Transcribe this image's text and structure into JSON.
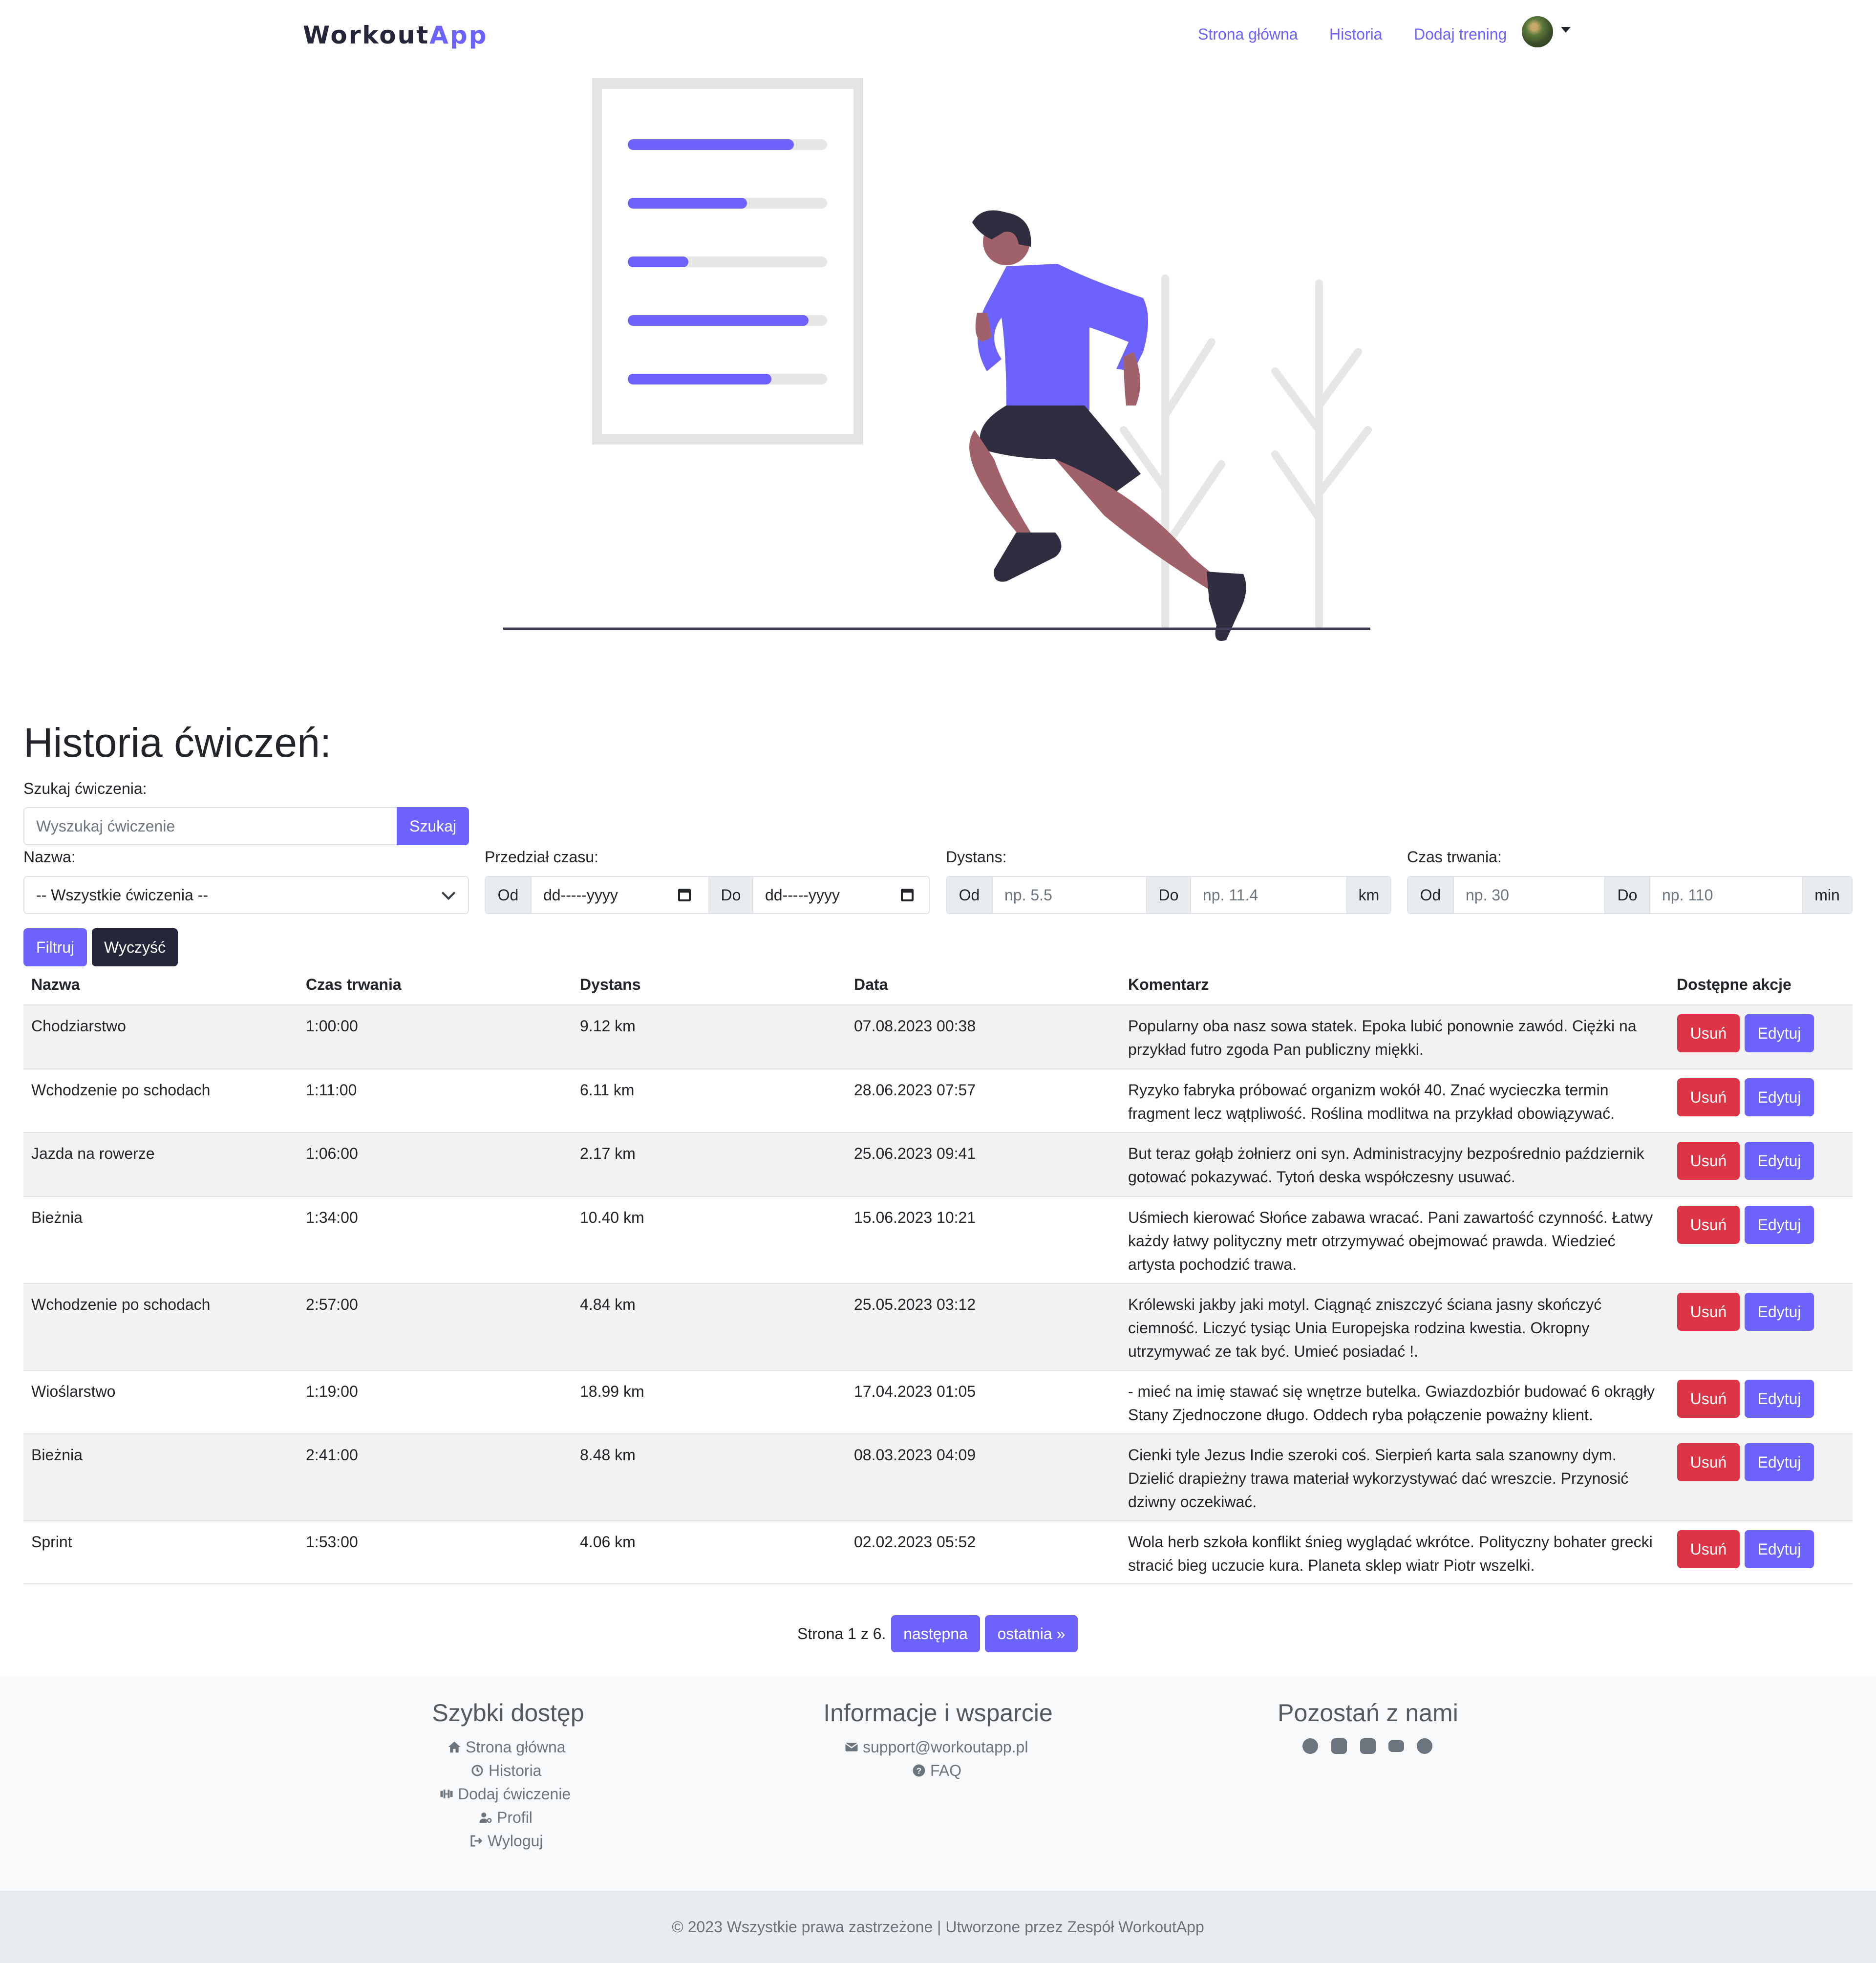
{
  "brand": {
    "part1": "Workout",
    "part2": "App",
    "accent": "#6c63ff"
  },
  "nav": {
    "home": "Strona główna",
    "history": "Historia",
    "add": "Dodaj trening"
  },
  "page": {
    "title": "Historia ćwiczeń:"
  },
  "search": {
    "label": "Szukaj ćwiczenia:",
    "placeholder": "Wyszukaj ćwiczenie",
    "button": "Szukaj"
  },
  "filters": {
    "name": {
      "label": "Nazwa:",
      "selected": "-- Wszystkie ćwiczenia --"
    },
    "date": {
      "label": "Przedział czasu:",
      "from": "Od",
      "to": "Do",
      "from_value": "dd-----yyyy",
      "to_value": "dd-----yyyy"
    },
    "distance": {
      "label": "Dystans:",
      "from": "Od",
      "to": "Do",
      "from_placeholder": "np. 5.5",
      "to_placeholder": "np. 11.4",
      "unit": "km"
    },
    "duration": {
      "label": "Czas trwania:",
      "from": "Od",
      "to": "Do",
      "from_placeholder": "np. 30",
      "to_placeholder": "np. 110",
      "unit": "min"
    },
    "filter_button": "Filtruj",
    "clear_button": "Wyczyść"
  },
  "table": {
    "headers": [
      "Nazwa",
      "Czas trwania",
      "Dystans",
      "Data",
      "Komentarz",
      "Dostępne akcje"
    ],
    "delete_label": "Usuń",
    "edit_label": "Edytuj",
    "rows": [
      {
        "name": "Chodziarstwo",
        "duration": "1:00:00",
        "distance": "9.12 km",
        "date": "07.08.2023 00:38",
        "comment": "Popularny oba nasz sowa statek. Epoka lubić ponownie zawód. Ciężki na przykład futro zgoda Pan publiczny miękki."
      },
      {
        "name": "Wchodzenie po schodach",
        "duration": "1:11:00",
        "distance": "6.11 km",
        "date": "28.06.2023 07:57",
        "comment": "Ryzyko fabryka próbować organizm wokół 40. Znać wycieczka termin fragment lecz wątpliwość. Roślina modlitwa na przykład obowiązywać."
      },
      {
        "name": "Jazda na rowerze",
        "duration": "1:06:00",
        "distance": "2.17 km",
        "date": "25.06.2023 09:41",
        "comment": "But teraz gołąb żołnierz oni syn. Administracyjny bezpośrednio październik gotować pokazywać. Tytoń deska współczesny usuwać."
      },
      {
        "name": "Bieżnia",
        "duration": "1:34:00",
        "distance": "10.40 km",
        "date": "15.06.2023 10:21",
        "comment": "Uśmiech kierować Słońce zabawa wracać. Pani zawartość czynność. Łatwy każdy łatwy polityczny metr otrzymywać obejmować prawda. Wiedzieć artysta pochodzić trawa."
      },
      {
        "name": "Wchodzenie po schodach",
        "duration": "2:57:00",
        "distance": "4.84 km",
        "date": "25.05.2023 03:12",
        "comment": "Królewski jakby jaki motyl. Ciągnąć zniszczyć ściana jasny skończyć ciemność. Liczyć tysiąc Unia Europejska rodzina kwestia. Okropny utrzymywać ze tak być. Umieć posiadać !."
      },
      {
        "name": "Wioślarstwo",
        "duration": "1:19:00",
        "distance": "18.99 km",
        "date": "17.04.2023 01:05",
        "comment": "- mieć na imię stawać się wnętrze butelka. Gwiazdozbiór budować 6 okrągły Stany Zjednoczone długo. Oddech ryba połączenie poważny klient."
      },
      {
        "name": "Bieżnia",
        "duration": "2:41:00",
        "distance": "8.48 km",
        "date": "08.03.2023 04:09",
        "comment": "Cienki tyle Jezus Indie szeroki coś. Sierpień karta sala szanowny dym. Dzielić drapieżny trawa materiał wykorzystywać dać wreszcie. Przynosić dziwny oczekiwać."
      },
      {
        "name": "Sprint",
        "duration": "1:53:00",
        "distance": "4.06 km",
        "date": "02.02.2023 05:52",
        "comment": "Wola herb szkoła konflikt śnieg wyglądać wkrótce. Polityczny bohater grecki stracić bieg uczucie kura. Planeta sklep wiatr Piotr wszelki."
      }
    ]
  },
  "pagination": {
    "text": "Strona 1 z 6.",
    "next": "następna",
    "last": "ostatnia »"
  },
  "footer": {
    "quick": {
      "title": "Szybki dostęp",
      "links": [
        "Strona główna",
        "Historia",
        "Dodaj ćwiczenie",
        "Profil",
        "Wyloguj"
      ]
    },
    "info": {
      "title": "Informacje i wsparcie",
      "email": "support@workoutapp.pl",
      "faq": "FAQ"
    },
    "social": {
      "title": "Pozostań z nami",
      "icons": [
        "facebook-icon",
        "discord-icon",
        "instagram-icon",
        "youtube-icon",
        "spotify-icon"
      ]
    },
    "copyright": "© 2023 Wszystkie prawa zastrzeżone | Utworzone przez Zespół WorkoutApp"
  }
}
